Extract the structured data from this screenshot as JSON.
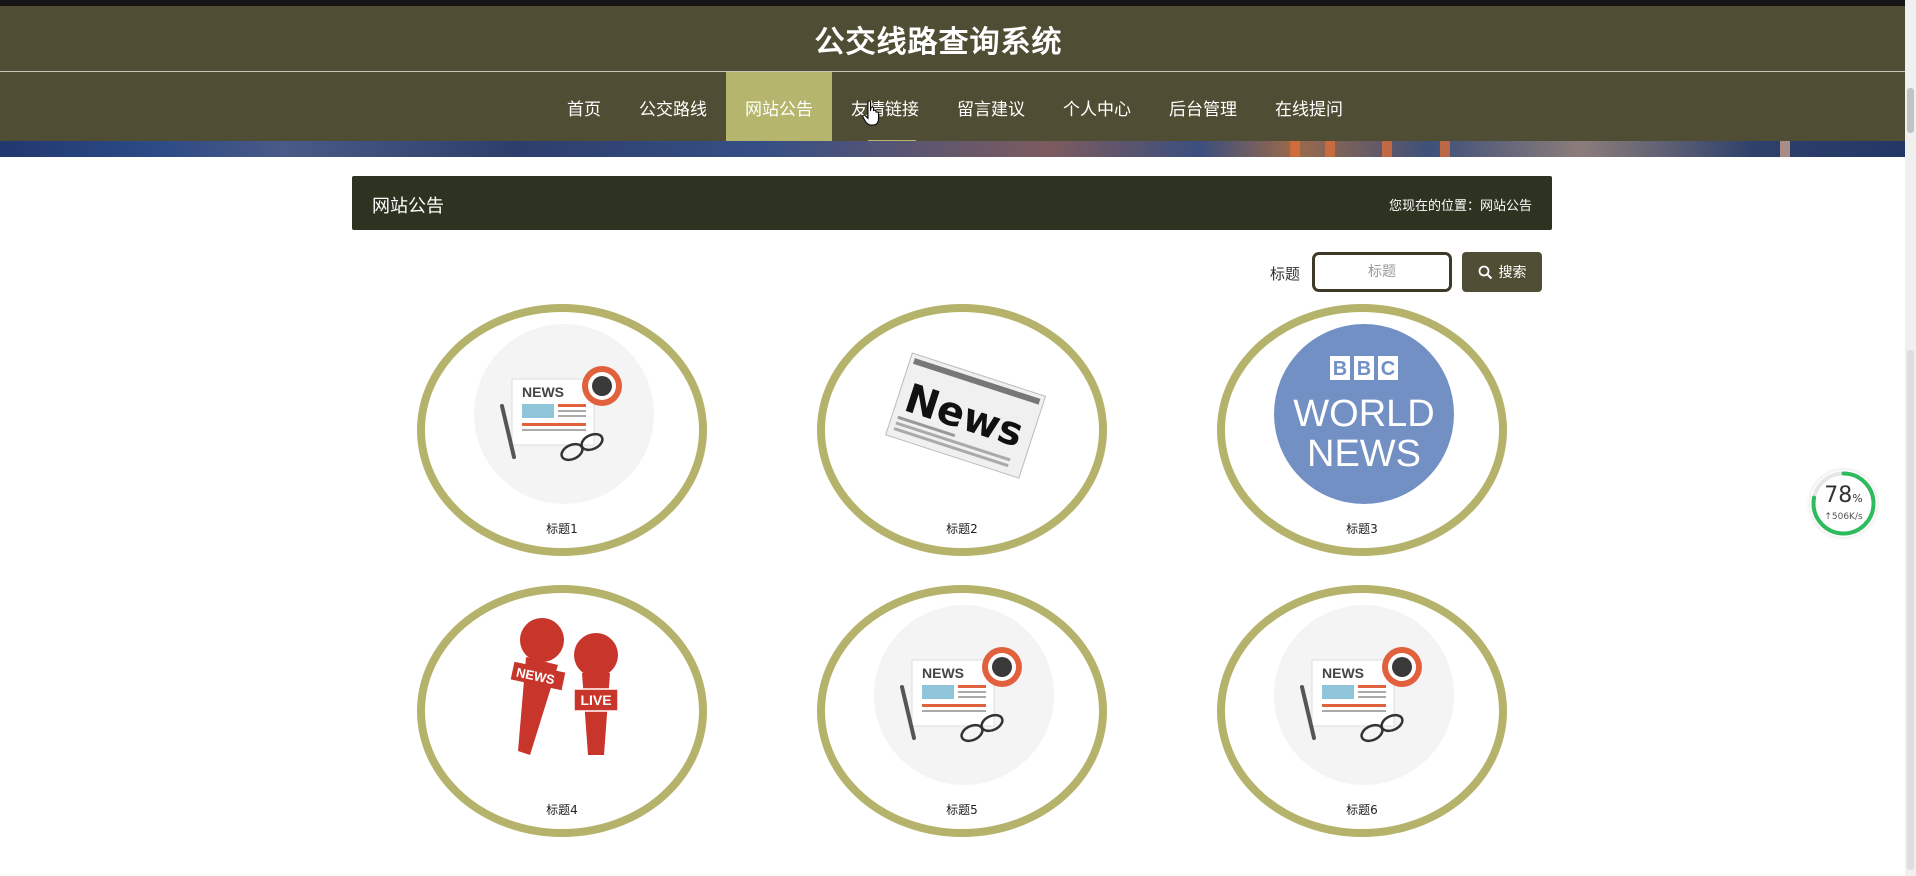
{
  "header": {
    "title": "公交线路查询系统"
  },
  "nav": {
    "items": [
      {
        "label": "首页"
      },
      {
        "label": "公交路线"
      },
      {
        "label": "网站公告",
        "active": true
      },
      {
        "label": "友情链接",
        "hovered": true
      },
      {
        "label": "留言建议"
      },
      {
        "label": "个人中心"
      },
      {
        "label": "后台管理"
      },
      {
        "label": "在线提问"
      }
    ]
  },
  "section": {
    "title": "网站公告",
    "breadcrumb_prefix": "您现在的位置：",
    "breadcrumb_current": "网站公告"
  },
  "search": {
    "label": "标题",
    "placeholder": "标题",
    "button_label": "搜索"
  },
  "cards": [
    {
      "caption": "标题1",
      "image": "news-desk-icon"
    },
    {
      "caption": "标题2",
      "image": "newspaper-icon"
    },
    {
      "caption": "标题3",
      "image": "bbc-world-news-logo"
    },
    {
      "caption": "标题4",
      "image": "news-microphones-icon"
    },
    {
      "caption": "标题5",
      "image": "news-desk-icon"
    },
    {
      "caption": "标题6",
      "image": "news-desk-icon"
    }
  ],
  "logos": {
    "bbc_line1": "BBC",
    "bbc_line2": "WORLD",
    "bbc_line3": "NEWS"
  },
  "art_text": {
    "news": "NEWS",
    "newspaper": "News",
    "live": "LIVE"
  },
  "speed_widget": {
    "percent": "78",
    "percent_unit": "%",
    "rate": "↑506K/s",
    "ring_fraction": 0.78
  },
  "colors": {
    "header_bg": "#4f4d33",
    "nav_active": "#b6b56e",
    "section_bar": "#2d3320",
    "card_ring": "#b5b36b"
  }
}
